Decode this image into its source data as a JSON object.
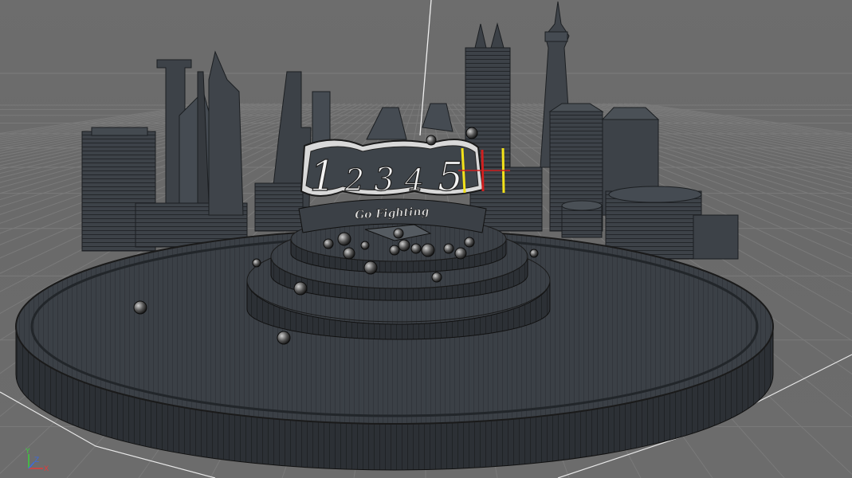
{
  "viewport": {
    "name": "perspective-viewport",
    "background_color": "#6b6b6b",
    "grid_color": "#7c7c7c",
    "mesh_color": "#3a3f45",
    "wire_color": "#1e1e1e"
  },
  "sign": {
    "digits": [
      "1",
      "2",
      "3",
      "4",
      "5"
    ],
    "banner_text": "Go Fighting",
    "selection_colors": {
      "primary": "#f3e21a",
      "secondary": "#d12020"
    }
  },
  "axis_gizmo": {
    "y_label": "Y",
    "z_label": "Z",
    "x_label": "X",
    "colors": {
      "x": "#e03c3c",
      "y": "#3ccf3c",
      "z": "#3c6be0"
    }
  },
  "objects": {
    "spheres_icon": "wireframe-sphere-icon",
    "buildings_icon": "skyscraper-icon"
  }
}
